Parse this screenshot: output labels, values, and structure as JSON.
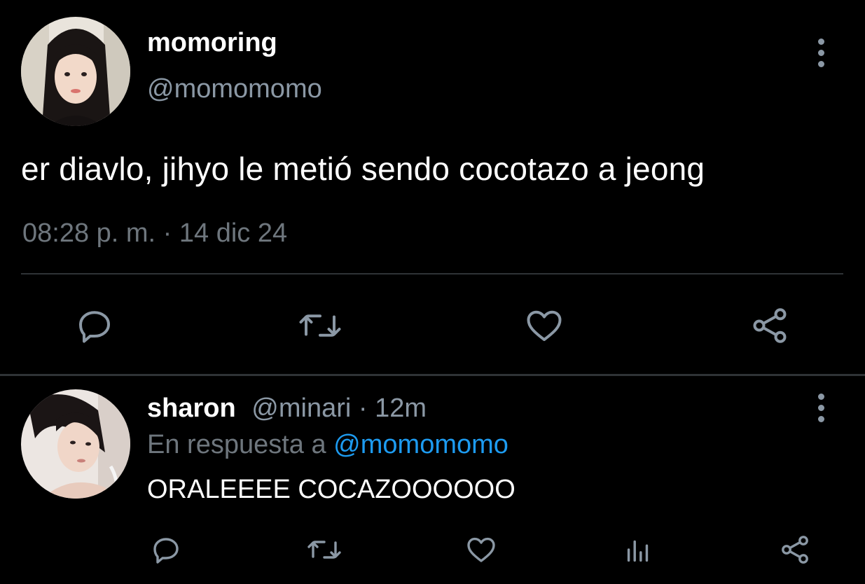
{
  "main_tweet": {
    "display_name": "momoring",
    "handle": "@momomomo",
    "text": "er diavlo, jihyo le metió sendo cocotazo a jeong",
    "timestamp": "08:28 p. m. · 14 dic 24",
    "actions": {
      "reply_icon": "reply-icon",
      "retweet_icon": "retweet-icon",
      "like_icon": "heart-icon",
      "share_icon": "share-icon"
    }
  },
  "reply_tweet": {
    "display_name": "sharon",
    "handle": "@minari",
    "separator": " · ",
    "time": "12m",
    "replying_to_label": "En respuesta a ",
    "replying_to_handle": "@momomomo",
    "text": "ORALEEEE COCAZOOOOOO",
    "actions": {
      "reply_icon": "reply-icon",
      "retweet_icon": "retweet-icon",
      "like_icon": "heart-icon",
      "views_icon": "views-icon",
      "share_icon": "share-icon"
    }
  },
  "colors": {
    "background": "#000000",
    "primary_text": "#ffffff",
    "secondary_text": "#8b98a5",
    "muted_text": "#6e767d",
    "link": "#1d9bf0",
    "divider": "#2f3336"
  }
}
